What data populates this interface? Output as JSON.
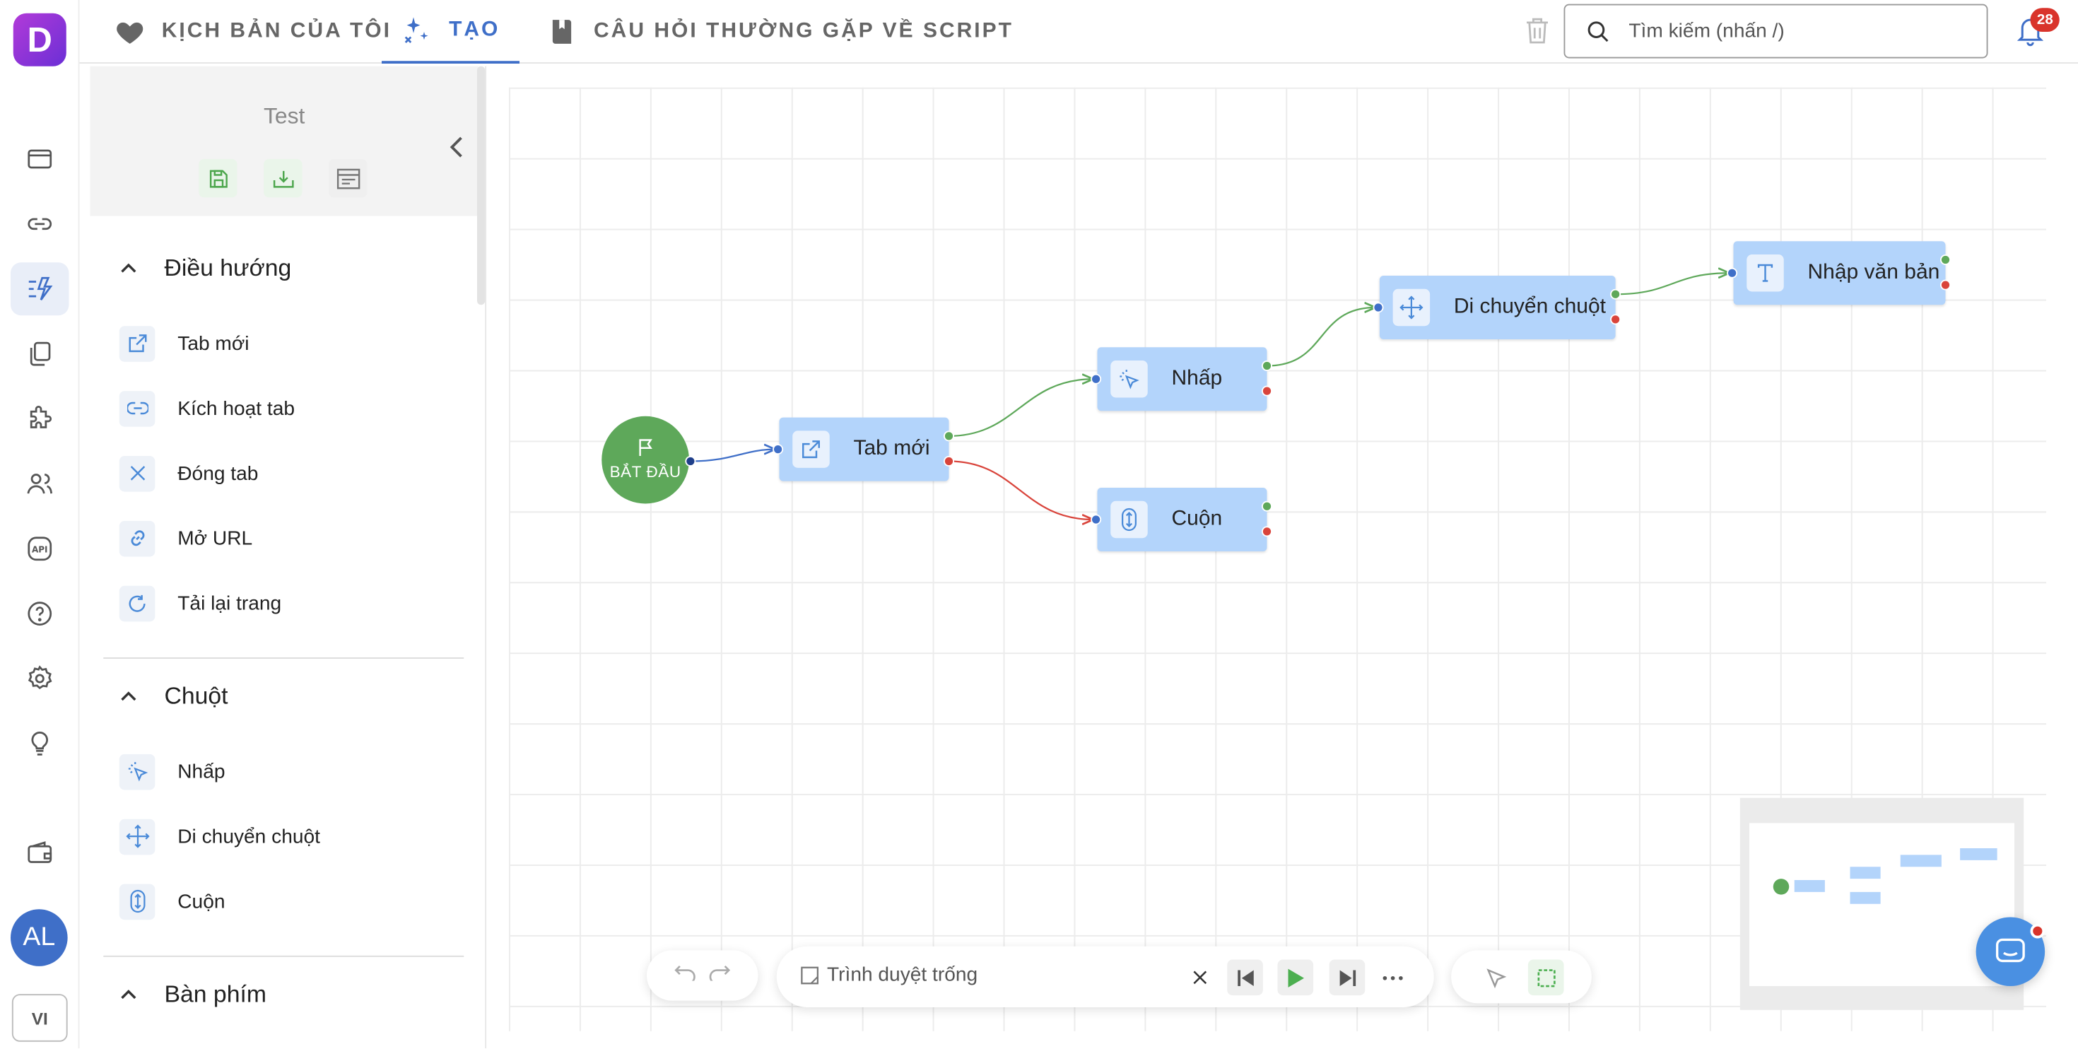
{
  "app": {
    "logo_letter": "D"
  },
  "nav": {
    "my_scripts": "KỊCH BẢN CỦA TÔI",
    "create": "TẠO",
    "faq": "CÂU HỎI THƯỜNG GẶP VỀ SCRIPT"
  },
  "search": {
    "placeholder": "Tìm kiếm (nhấn /)"
  },
  "notifications": {
    "count": "28"
  },
  "user": {
    "initials": "AL",
    "language": "VI"
  },
  "script": {
    "name": "Test"
  },
  "sidebar": {
    "sections": [
      {
        "title": "Điều hướng",
        "items": [
          "Tab mới",
          "Kích hoạt tab",
          "Đóng tab",
          "Mở URL",
          "Tải lại trang"
        ]
      },
      {
        "title": "Chuột",
        "items": [
          "Nhấp",
          "Di chuyển chuột",
          "Cuộn"
        ]
      },
      {
        "title": "Bàn phím",
        "items": []
      }
    ]
  },
  "flow": {
    "start_label": "BẮT ĐẦU",
    "nodes": [
      "Tab mới",
      "Nhấp",
      "Cuộn",
      "Di chuyển chuột",
      "Nhập văn bản"
    ]
  },
  "toolbar": {
    "browser_label": "Trình duyệt trống"
  },
  "colors": {
    "accent": "#3f6fc8",
    "node": "#b3d4fb",
    "start": "#5ea85a",
    "success_edge": "#5ea85a",
    "fail_edge": "#d9443b"
  }
}
